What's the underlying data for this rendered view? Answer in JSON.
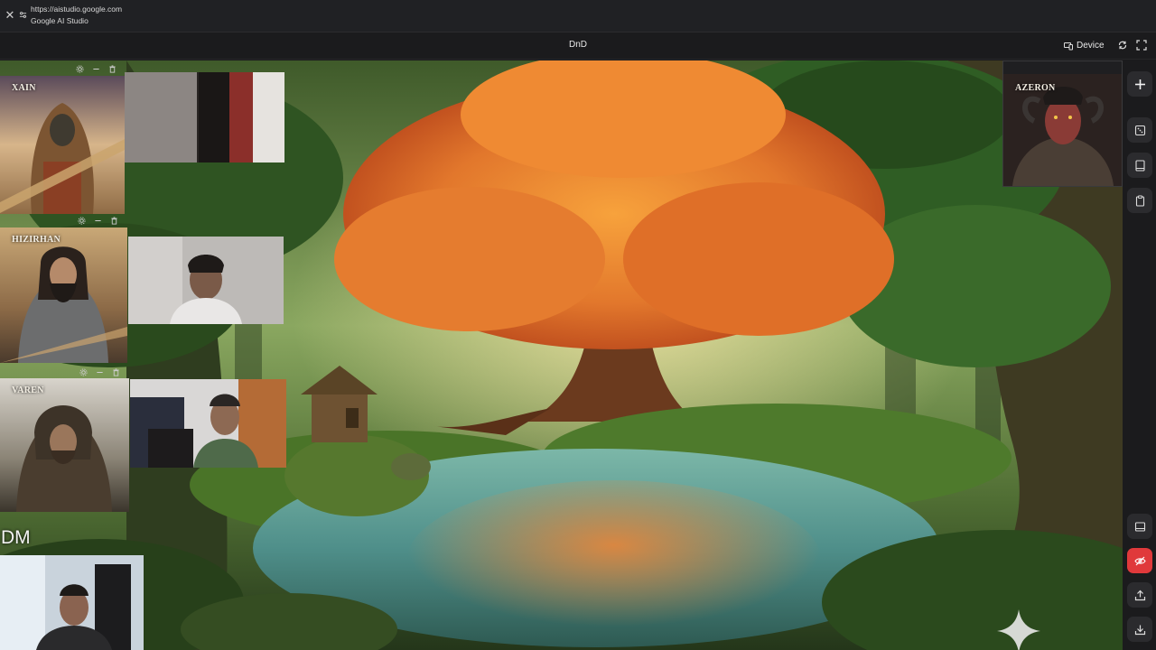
{
  "browser": {
    "url": "https://aistudio.google.com",
    "site_name": "Google AI Studio"
  },
  "app": {
    "title": "DnD",
    "device_label": "Device"
  },
  "characters": [
    {
      "name": "XAIN"
    },
    {
      "name": "HIZIRHAN"
    },
    {
      "name": "VAREN"
    },
    {
      "name": "AZERON"
    }
  ],
  "dm_label": "DM",
  "icons": {
    "close": "close-icon",
    "site_info": "tune-icon",
    "device": "device-icon",
    "refresh": "refresh-icon",
    "fullscreen": "fullscreen-icon",
    "tile_settings": "gear-icon",
    "tile_minimize": "minimize-icon",
    "tile_delete": "trash-icon",
    "rail": [
      "add-icon",
      "dice-icon",
      "tablet-icon",
      "clipboard-icon",
      "screen-icon",
      "hide-icon",
      "upload-icon",
      "download-icon"
    ]
  },
  "colors": {
    "app_bg": "#1b1b1d",
    "rail_button": "#2b2b2e",
    "hide_button_active": "#e0393b",
    "canopy": "#e2772c"
  }
}
